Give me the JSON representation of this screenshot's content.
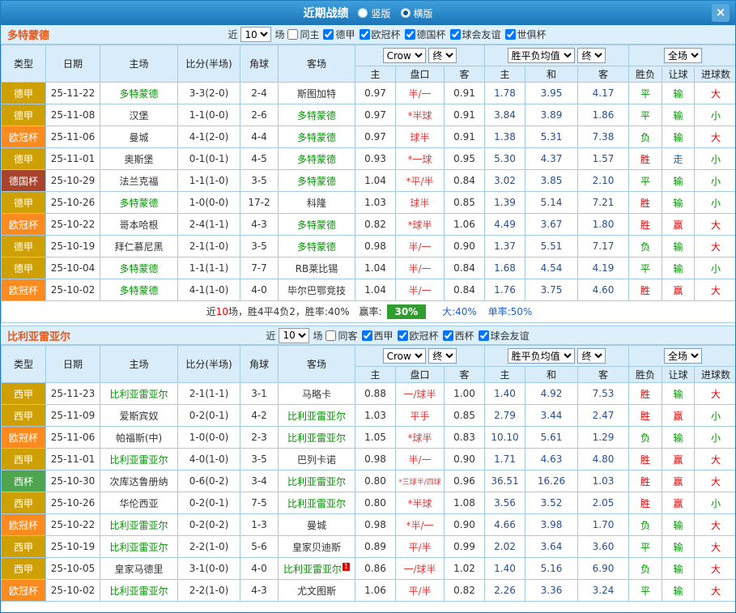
{
  "titlebar": {
    "title": "近期战绩",
    "layout_radios": [
      {
        "label": "竖版",
        "selected": false
      },
      {
        "label": "横版",
        "selected": true
      }
    ],
    "close_icon": "×"
  },
  "colors": {
    "titlebar_blue": "#1B74B6",
    "header_bg": "#D9ECF9",
    "border_blue": "#A4CBE4",
    "section_title_orange": "#E4581C",
    "team_highlight_green": "#029402",
    "league_yellow": "#CFA004",
    "cup_orange": "#FC8B1F",
    "cup_dark_red": "#A8432C",
    "cup_green": "#4EA54E",
    "handicap_red": "#E43A3A",
    "avg_navy": "#28508C",
    "win_red": "#E60000",
    "push_blue": "#1E62CC",
    "winrate_badge_green": "#2F9E2F"
  },
  "table_header": {
    "type": "类型",
    "date": "日期",
    "home": "主场",
    "score": "比分(半场)",
    "corner": "角球",
    "away": "客场",
    "bookmaker": "Crow",
    "final_label": "终",
    "wdl_avg": "胜平负均值",
    "scope": "全场",
    "sub": [
      "主",
      "盘口",
      "客",
      "主",
      "和",
      "客",
      "胜负",
      "让球",
      "进球数"
    ]
  },
  "sections": [
    {
      "team_title": "多特蒙德",
      "filter": {
        "near": "近",
        "count": "10",
        "unit": "场",
        "checkboxes": [
          {
            "label": "同主",
            "checked": false
          },
          {
            "label": "德甲",
            "checked": true
          },
          {
            "label": "欧冠杯",
            "checked": true
          },
          {
            "label": "德国杯",
            "checked": true
          },
          {
            "label": "球会友谊",
            "checked": true
          },
          {
            "label": "世俱杯",
            "checked": true
          }
        ]
      },
      "rows": [
        {
          "type": "德甲",
          "tc": "yellow",
          "date": "25-11-22",
          "home": "多特蒙德",
          "hh": true,
          "score": "3-3(2-0)",
          "corner": "2-4",
          "away": "斯图加特",
          "ah": false,
          "o1": "0.97",
          "pk": "半/一",
          "o2": "0.91",
          "a1": "1.78",
          "a2": "3.95",
          "a3": "4.17",
          "res": "平",
          "resc": "green",
          "let": "输",
          "letc": "green",
          "gl": "大",
          "glc": "red"
        },
        {
          "type": "德甲",
          "tc": "yellow",
          "date": "25-11-08",
          "home": "汉堡",
          "hh": false,
          "score": "1-1(0-0)",
          "corner": "2-6",
          "away": "多特蒙德",
          "ah": true,
          "o1": "0.97",
          "pk": "*半球",
          "o2": "0.91",
          "a1": "3.84",
          "a2": "3.89",
          "a3": "1.86",
          "res": "平",
          "resc": "green",
          "let": "输",
          "letc": "green",
          "gl": "小",
          "glc": "green"
        },
        {
          "type": "欧冠杯",
          "tc": "orange",
          "date": "25-11-06",
          "home": "曼城",
          "hh": false,
          "score": "4-1(2-0)",
          "corner": "4-4",
          "away": "多特蒙德",
          "ah": true,
          "o1": "0.97",
          "pk": "球半",
          "o2": "0.91",
          "a1": "1.38",
          "a2": "5.31",
          "a3": "7.38",
          "res": "负",
          "resc": "green",
          "let": "输",
          "letc": "green",
          "gl": "大",
          "glc": "red"
        },
        {
          "type": "德甲",
          "tc": "yellow",
          "date": "25-11-01",
          "home": "奥斯堡",
          "hh": false,
          "score": "0-1(0-1)",
          "corner": "4-5",
          "away": "多特蒙德",
          "ah": true,
          "o1": "0.93",
          "pk": "*一球",
          "o2": "0.95",
          "a1": "5.30",
          "a2": "4.37",
          "a3": "1.57",
          "res": "胜",
          "resc": "red",
          "let": "走",
          "letc": "blue",
          "gl": "小",
          "glc": "green"
        },
        {
          "type": "德国杯",
          "tc": "darkred",
          "date": "25-10-29",
          "home": "法兰克福",
          "hh": false,
          "score": "1-1(1-0)",
          "corner": "3-5",
          "away": "多特蒙德",
          "ah": true,
          "o1": "1.04",
          "pk": "*平/半",
          "o2": "0.84",
          "a1": "3.02",
          "a2": "3.85",
          "a3": "2.10",
          "res": "平",
          "resc": "green",
          "let": "输",
          "letc": "green",
          "gl": "小",
          "glc": "green"
        },
        {
          "type": "德甲",
          "tc": "yellow",
          "date": "25-10-26",
          "home": "多特蒙德",
          "hh": true,
          "score": "1-0(0-0)",
          "corner": "17-2",
          "away": "科隆",
          "ah": false,
          "o1": "1.03",
          "pk": "球半",
          "o2": "0.85",
          "a1": "1.39",
          "a2": "5.14",
          "a3": "7.21",
          "res": "胜",
          "resc": "red",
          "let": "输",
          "letc": "green",
          "gl": "小",
          "glc": "green"
        },
        {
          "type": "欧冠杯",
          "tc": "orange",
          "date": "25-10-22",
          "home": "哥本哈根",
          "hh": false,
          "score": "2-4(1-1)",
          "corner": "4-3",
          "away": "多特蒙德",
          "ah": true,
          "o1": "0.82",
          "pk": "*球半",
          "o2": "1.06",
          "a1": "4.49",
          "a2": "3.67",
          "a3": "1.80",
          "res": "胜",
          "resc": "red",
          "let": "赢",
          "letc": "red",
          "gl": "大",
          "glc": "red"
        },
        {
          "type": "德甲",
          "tc": "yellow",
          "date": "25-10-19",
          "home": "拜仁慕尼黑",
          "hh": false,
          "score": "2-1(1-0)",
          "corner": "3-5",
          "away": "多特蒙德",
          "ah": true,
          "o1": "0.98",
          "pk": "半/一",
          "o2": "0.90",
          "a1": "1.37",
          "a2": "5.51",
          "a3": "7.17",
          "res": "负",
          "resc": "green",
          "let": "输",
          "letc": "green",
          "gl": "大",
          "glc": "red"
        },
        {
          "type": "德甲",
          "tc": "yellow",
          "date": "25-10-04",
          "home": "多特蒙德",
          "hh": true,
          "score": "1-1(1-1)",
          "corner": "7-7",
          "away": "RB莱比锡",
          "ah": false,
          "o1": "1.04",
          "pk": "半/一",
          "o2": "0.84",
          "a1": "1.68",
          "a2": "4.54",
          "a3": "4.19",
          "res": "平",
          "resc": "green",
          "let": "输",
          "letc": "green",
          "gl": "小",
          "glc": "green"
        },
        {
          "type": "欧冠杯",
          "tc": "orange",
          "date": "25-10-02",
          "home": "多特蒙德",
          "hh": true,
          "score": "4-1(1-0)",
          "corner": "4-0",
          "away": "毕尔巴鄂竞技",
          "ah": false,
          "o1": "1.04",
          "pk": "半/一",
          "o2": "0.84",
          "a1": "1.76",
          "a2": "3.75",
          "a3": "4.60",
          "res": "胜",
          "resc": "red",
          "let": "赢",
          "letc": "red",
          "gl": "大",
          "glc": "red"
        }
      ],
      "summary": {
        "near": "近",
        "count": "10",
        "record": "场，胜4平4负2，胜率:40%",
        "win_label": "赢率:",
        "win_value": "30%",
        "big_rate": "大:40%",
        "odd_rate": "单率:50%"
      }
    },
    {
      "team_title": "比利亚雷亚尔",
      "filter": {
        "near": "近",
        "count": "10",
        "unit": "场",
        "checkboxes": [
          {
            "label": "同客",
            "checked": false
          },
          {
            "label": "西甲",
            "checked": true
          },
          {
            "label": "欧冠杯",
            "checked": true
          },
          {
            "label": "西杯",
            "checked": true
          },
          {
            "label": "球会友谊",
            "checked": true
          }
        ]
      },
      "rows": [
        {
          "type": "西甲",
          "tc": "yellow",
          "date": "25-11-23",
          "home": "比利亚雷亚尔",
          "hh": true,
          "score": "2-1(1-1)",
          "corner": "3-1",
          "away": "马略卡",
          "ah": false,
          "o1": "0.88",
          "pk": "一/球半",
          "o2": "1.00",
          "a1": "1.40",
          "a2": "4.92",
          "a3": "7.53",
          "res": "胜",
          "resc": "red",
          "let": "输",
          "letc": "green",
          "gl": "大",
          "glc": "red"
        },
        {
          "type": "西甲",
          "tc": "yellow",
          "date": "25-11-09",
          "home": "爱斯宾奴",
          "hh": false,
          "score": "0-2(0-1)",
          "corner": "4-2",
          "away": "比利亚雷亚尔",
          "ah": true,
          "o1": "1.03",
          "pk": "平手",
          "o2": "0.85",
          "a1": "2.79",
          "a2": "3.44",
          "a3": "2.47",
          "res": "胜",
          "resc": "red",
          "let": "赢",
          "letc": "red",
          "gl": "小",
          "glc": "green"
        },
        {
          "type": "欧冠杯",
          "tc": "orange",
          "date": "25-11-06",
          "home": "帕福斯(中)",
          "hh": false,
          "score": "1-0(0-0)",
          "corner": "2-3",
          "away": "比利亚雷亚尔",
          "ah": true,
          "o1": "1.05",
          "pk": "*球半",
          "o2": "0.83",
          "a1": "10.10",
          "a2": "5.61",
          "a3": "1.29",
          "res": "负",
          "resc": "green",
          "let": "输",
          "letc": "green",
          "gl": "小",
          "glc": "green"
        },
        {
          "type": "西甲",
          "tc": "yellow",
          "date": "25-11-01",
          "home": "比利亚雷亚尔",
          "hh": true,
          "score": "4-0(1-0)",
          "corner": "3-5",
          "away": "巴列卡诺",
          "ah": false,
          "o1": "0.98",
          "pk": "半/一",
          "o2": "0.90",
          "a1": "1.71",
          "a2": "4.63",
          "a3": "4.80",
          "res": "胜",
          "resc": "red",
          "let": "赢",
          "letc": "red",
          "gl": "大",
          "glc": "red"
        },
        {
          "type": "西杯",
          "tc": "green",
          "date": "25-10-30",
          "home": "次库达鲁册纳",
          "hh": false,
          "score": "0-6(0-2)",
          "corner": "3-4",
          "away": "比利亚雷亚尔",
          "ah": true,
          "o1": "0.80",
          "pk": "*三球半/四球",
          "o2": "0.96",
          "a1": "36.51",
          "a2": "16.26",
          "a3": "1.03",
          "res": "胜",
          "resc": "red",
          "let": "赢",
          "letc": "red",
          "gl": "大",
          "glc": "red"
        },
        {
          "type": "西甲",
          "tc": "yellow",
          "date": "25-10-26",
          "home": "华伦西亚",
          "hh": false,
          "score": "0-2(0-1)",
          "corner": "7-5",
          "away": "比利亚雷亚尔",
          "ah": true,
          "o1": "0.80",
          "pk": "*半球",
          "o2": "1.08",
          "a1": "3.56",
          "a2": "3.52",
          "a3": "2.05",
          "res": "胜",
          "resc": "red",
          "let": "赢",
          "letc": "red",
          "gl": "小",
          "glc": "green"
        },
        {
          "type": "欧冠杯",
          "tc": "orange",
          "date": "25-10-22",
          "home": "比利亚雷亚尔",
          "hh": true,
          "score": "0-2(0-2)",
          "corner": "1-3",
          "away": "曼城",
          "ah": false,
          "o1": "0.98",
          "pk": "*半/一",
          "o2": "0.90",
          "a1": "4.66",
          "a2": "3.98",
          "a3": "1.70",
          "res": "负",
          "resc": "green",
          "let": "输",
          "letc": "green",
          "gl": "大",
          "glc": "red"
        },
        {
          "type": "西甲",
          "tc": "yellow",
          "date": "25-10-19",
          "home": "比利亚雷亚尔",
          "hh": true,
          "score": "2-2(1-0)",
          "corner": "5-6",
          "away": "皇家贝迪斯",
          "ah": false,
          "o1": "0.89",
          "pk": "平/半",
          "o2": "0.99",
          "a1": "2.02",
          "a2": "3.64",
          "a3": "3.60",
          "res": "平",
          "resc": "green",
          "let": "输",
          "letc": "green",
          "gl": "大",
          "glc": "red"
        },
        {
          "type": "西甲",
          "tc": "yellow",
          "date": "25-10-05",
          "home": "皇家马德里",
          "hh": false,
          "score": "3-1(0-0)",
          "corner": "4-0",
          "away": "比利亚雷亚尔",
          "ah": true,
          "sup": "1",
          "o1": "0.86",
          "pk": "一/球半",
          "o2": "1.02",
          "a1": "1.40",
          "a2": "5.16",
          "a3": "6.90",
          "res": "负",
          "resc": "green",
          "let": "输",
          "letc": "green",
          "gl": "大",
          "glc": "red"
        },
        {
          "type": "欧冠杯",
          "tc": "orange",
          "date": "25-10-02",
          "home": "比利亚雷亚尔",
          "hh": true,
          "score": "2-2(1-0)",
          "corner": "4-3",
          "away": "尤文图斯",
          "ah": false,
          "o1": "1.06",
          "pk": "平/半",
          "o2": "0.82",
          "a1": "2.26",
          "a2": "3.36",
          "a3": "3.24",
          "res": "平",
          "resc": "green",
          "let": "输",
          "letc": "green",
          "gl": "大",
          "glc": "red"
        }
      ]
    }
  ]
}
